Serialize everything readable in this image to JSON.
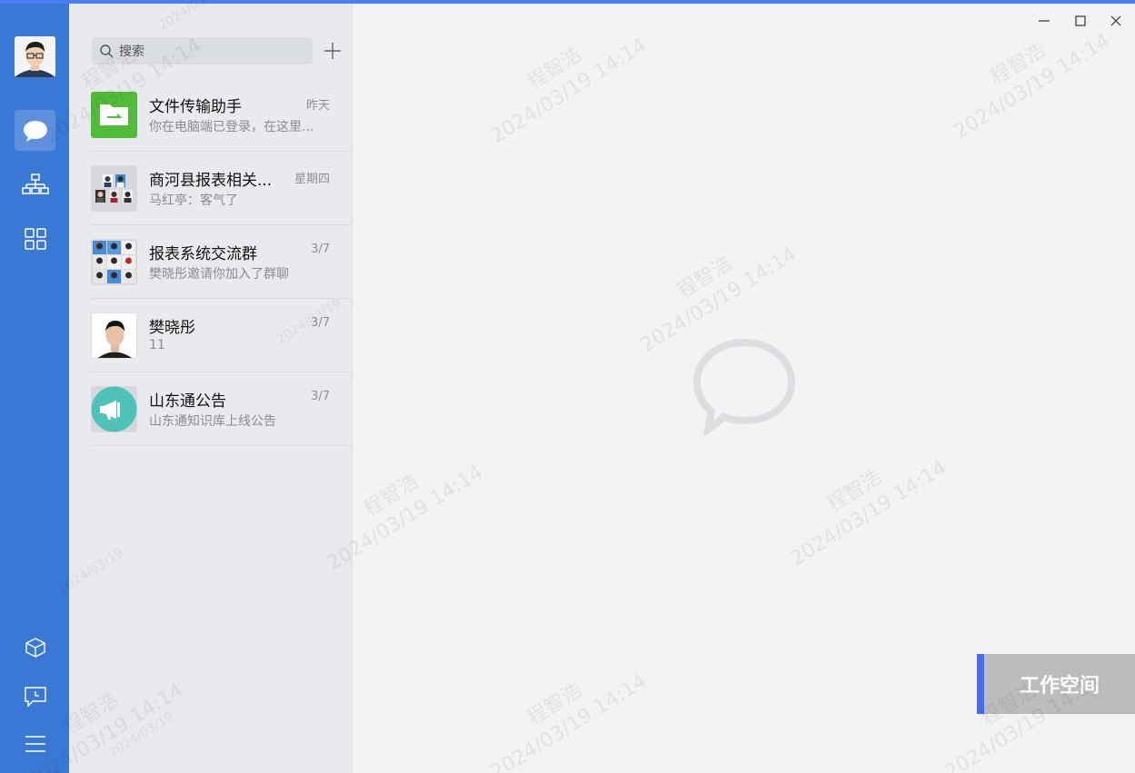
{
  "search": {
    "placeholder": "搜索"
  },
  "conversations": [
    {
      "name": "文件传输助手",
      "time": "昨天",
      "preview": "你在电脑端已登录，在这里..."
    },
    {
      "name": "商河县报表相关...",
      "time": "星期四",
      "preview": "马红亭：客气了"
    },
    {
      "name": "报表系统交流群",
      "time": "3/7",
      "preview": "樊晓彤邀请你加入了群聊"
    },
    {
      "name": "樊晓彤",
      "time": "3/7",
      "preview": "11"
    },
    {
      "name": "山东通公告",
      "time": "3/7",
      "preview": "山东通知识库上线公告"
    }
  ],
  "workspace": {
    "label": "工作空间"
  },
  "watermark": {
    "name": "程智浩",
    "datetime": "2024/03/19 14:14",
    "date": "2024/03/19"
  },
  "colors": {
    "nav": "#3a78d6",
    "accent": "#4a7ef2",
    "file_helper": "#53bb3a",
    "notice": "#4fc3b9"
  }
}
